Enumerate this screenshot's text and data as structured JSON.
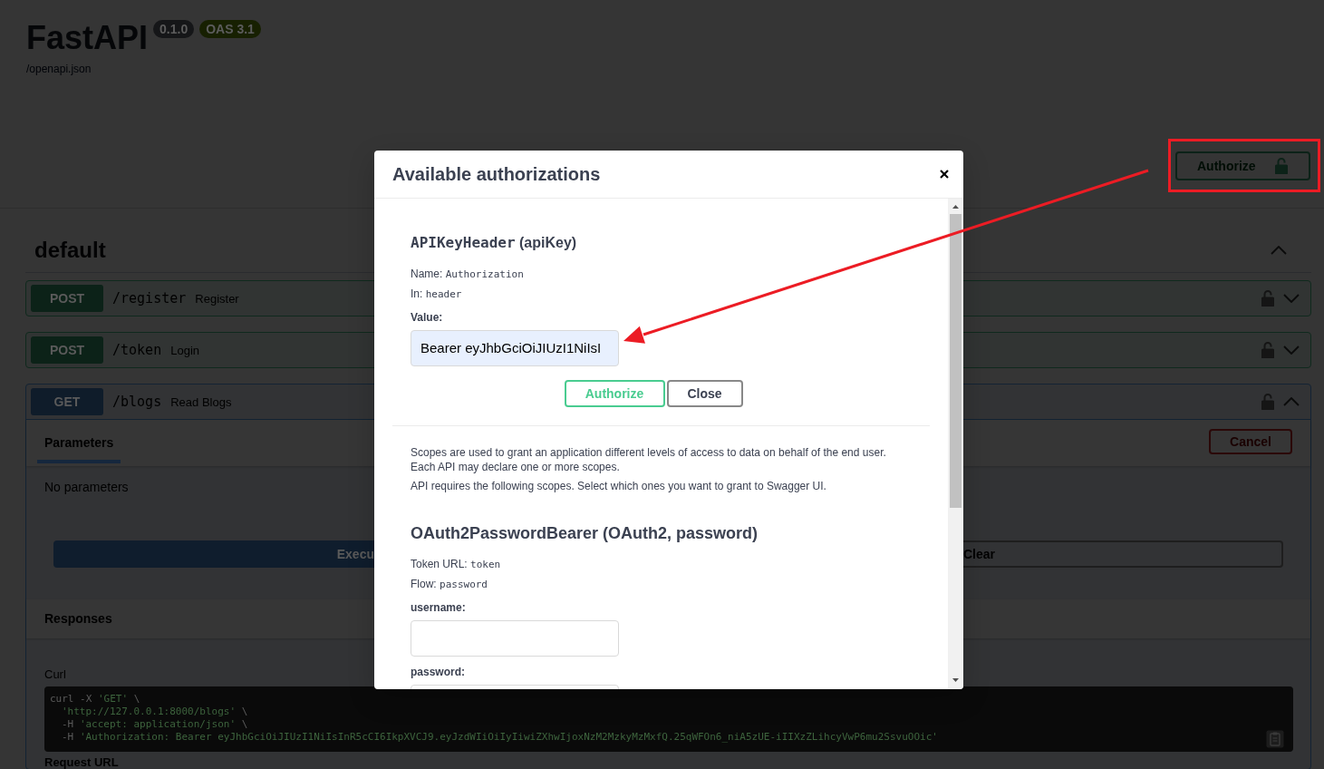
{
  "header": {
    "title": "FastAPI",
    "version": "0.1.0",
    "oas": "OAS 3.1",
    "spec_link": "/openapi.json"
  },
  "authorize_button": {
    "label": "Authorize",
    "locked": false
  },
  "tag": {
    "name": "default",
    "expanded": true
  },
  "operations": [
    {
      "kind": "post",
      "method": "POST",
      "path": "/register",
      "summary": "Register",
      "locked": false,
      "expanded": false
    },
    {
      "kind": "post",
      "method": "POST",
      "path": "/token",
      "summary": "Login",
      "locked": false,
      "expanded": false
    },
    {
      "kind": "get",
      "method": "GET",
      "path": "/blogs",
      "summary": "Read Blogs",
      "locked": false,
      "expanded": true,
      "detail": {
        "tabs": [
          {
            "label": "Parameters",
            "selected": true
          }
        ],
        "cancel": "Cancel",
        "no_parameters": "No parameters",
        "execute": "Execu",
        "clear": "Clear",
        "responses": "Responses",
        "curl_label": "Curl",
        "curl_lines": [
          {
            "indented": false,
            "parts": [
              {
                "kind": "plain",
                "text": "curl -X "
              },
              {
                "kind": "string",
                "text": "'GET'"
              },
              {
                "kind": "plain",
                "text": " \\"
              }
            ]
          },
          {
            "indented": true,
            "parts": [
              {
                "kind": "string",
                "text": "'http://127.0.0.1:8000/blogs'"
              },
              {
                "kind": "plain",
                "text": " \\"
              }
            ]
          },
          {
            "indented": true,
            "parts": [
              {
                "kind": "plain",
                "text": "-H "
              },
              {
                "kind": "string",
                "text": "'accept: application/json'"
              },
              {
                "kind": "plain",
                "text": " \\"
              }
            ]
          },
          {
            "indented": true,
            "parts": [
              {
                "kind": "plain",
                "text": "-H "
              },
              {
                "kind": "string",
                "text": "'Authorization: Bearer eyJhbGciOiJIUzI1NiIsInR5cCI6IkpXVCJ9.eyJzdWIiOiIyIiwiZXhwIjoxNzM2MzkyMzMxfQ.25qWFOn6_niA5zUE-iIIXzZLihcyVwP6mu2SsvuOOic'"
              }
            ]
          }
        ],
        "request_url_label": "Request URL"
      }
    }
  ],
  "modal": {
    "title": "Available authorizations",
    "sections": [
      {
        "kind": "apikey",
        "title_code": "APIKeyHeader",
        "title_rest": "(apiKey)",
        "details": [
          {
            "label": "Name:",
            "value": "Authorization"
          },
          {
            "label": "In:",
            "value": "header"
          }
        ],
        "value_label": "Value:",
        "value": "Bearer eyJhbGciOiJIUzI1NiIsI",
        "buttons": [
          {
            "kind": "primary",
            "label": "Authorize"
          },
          {
            "kind": "secondary",
            "label": "Close"
          }
        ]
      },
      {
        "kind": "oauth2",
        "description": [
          "Scopes are used to grant an application different levels of access to data on behalf of the end user. Each API may declare one or more scopes.",
          "API requires the following scopes. Select which ones you want to grant to Swagger UI."
        ],
        "title": "OAuth2PasswordBearer (OAuth2, password)",
        "details": [
          {
            "label": "Token URL:",
            "value": "token"
          },
          {
            "label": "Flow:",
            "value": "password"
          }
        ],
        "fields": [
          {
            "label": "username:"
          },
          {
            "label": "password:"
          }
        ]
      }
    ]
  }
}
